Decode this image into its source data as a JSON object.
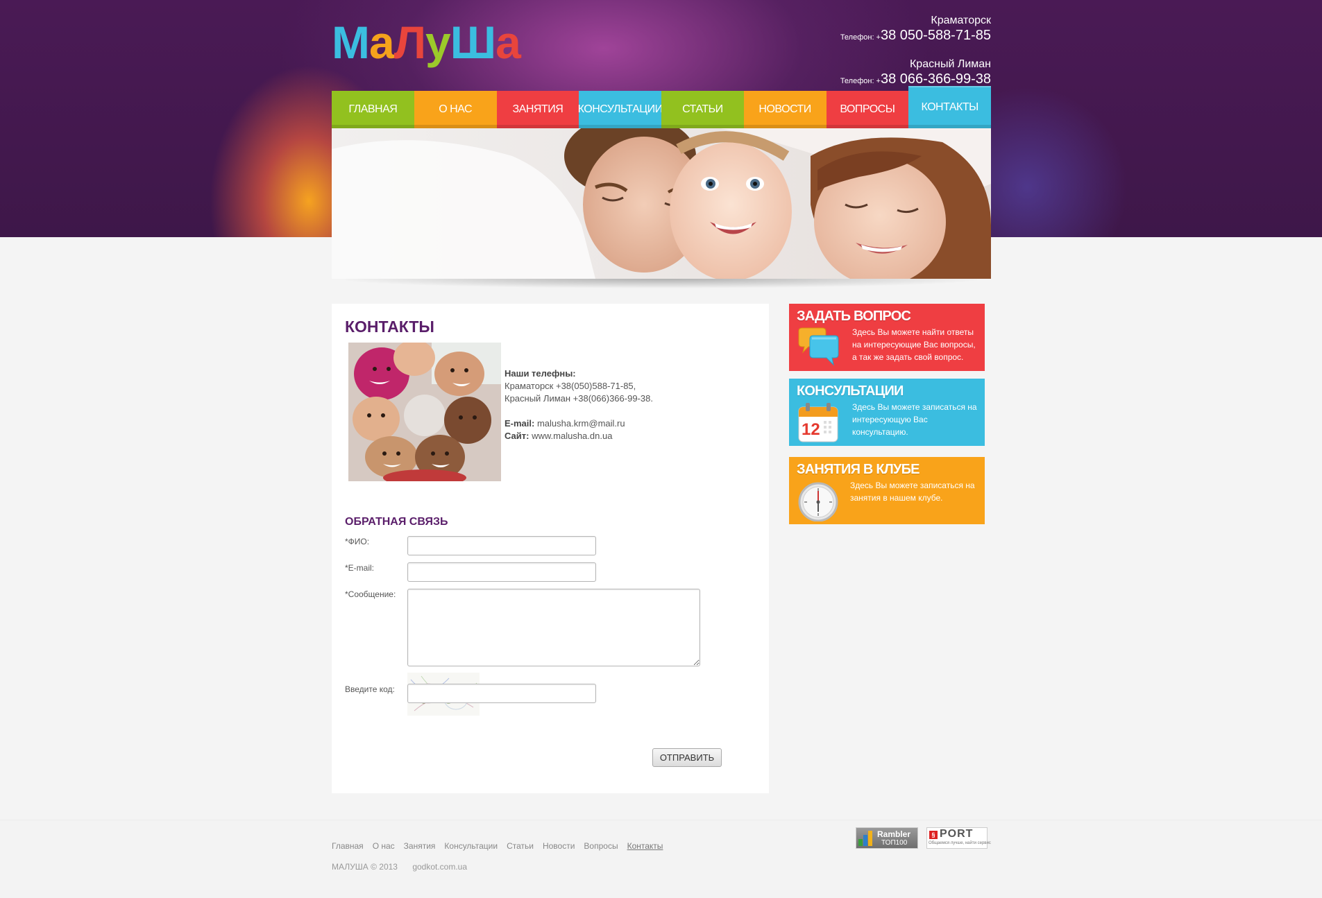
{
  "brand": {
    "logo_letters": [
      {
        "char": "М",
        "color": "#3bbde0"
      },
      {
        "char": "а",
        "color": "#f5a21c"
      },
      {
        "char": "Л",
        "color": "#e8453c"
      },
      {
        "char": "у",
        "color": "#9cc92a"
      },
      {
        "char": "Ш",
        "color": "#3bbde0"
      },
      {
        "char": "а",
        "color": "#e8453c"
      }
    ]
  },
  "header": {
    "city1": "Краматорск",
    "phone1_label": "Телефон: +",
    "phone1": "38 050-588-71-85",
    "city2": "Красный Лиман",
    "phone2_label": "Телефон: +",
    "phone2": "38 066-366-99-38"
  },
  "nav": {
    "items": [
      {
        "label": "ГЛАВНАЯ",
        "color": "#92c11f",
        "active": false
      },
      {
        "label": "О НАС",
        "color": "#f9a31a",
        "active": false
      },
      {
        "label": "ЗАНЯТИЯ",
        "color": "#ef3e42",
        "active": false
      },
      {
        "label": "КОНСУЛЬТАЦИИ",
        "color": "#3bbde0",
        "active": false
      },
      {
        "label": "СТАТЬИ",
        "color": "#92c11f",
        "active": false
      },
      {
        "label": "НОВОСТИ",
        "color": "#f9a31a",
        "active": false
      },
      {
        "label": "ВОПРОСЫ",
        "color": "#ef3e42",
        "active": false
      },
      {
        "label": "КОНТАКТЫ",
        "color": "#3bbde0",
        "active": true
      }
    ]
  },
  "main": {
    "title": "КОНТАКТЫ",
    "phones_label": "Наши телефны:",
    "phone_line1": "Краматорск +38(050)588-71-85,",
    "phone_line2": "Красный Лиман +38(066)366-99-38.",
    "email_label": "E-mail:",
    "email": "malusha.krm@mail.ru",
    "site_label": "Сайт:",
    "site": "www.malusha.dn.ua"
  },
  "feedback": {
    "title": "ОБРАТНАЯ СВЯЗЬ",
    "name_label": "*ФИО:",
    "name_value": "",
    "email_label": "*E-mail:",
    "email_value": "",
    "message_label": "*Сообщение:",
    "message_value": "",
    "captcha_text": "b8cv",
    "code_label": "Введите код:",
    "code_value": "",
    "submit_label": "ОТПРАВИТЬ"
  },
  "sidebar": {
    "widgets": [
      {
        "title": "ЗАДАТЬ ВОПРОС",
        "text": "Здесь Вы можете найти ответы на интересующие Вас вопросы, а так же задать свой вопрос.",
        "color": "#ef3e42",
        "icon": "chat-bubbles-icon"
      },
      {
        "title": "КОНСУЛЬТАЦИИ",
        "text": "Здесь Вы можете записаться на интересующую Вас консультацию.",
        "color": "#3bbde0",
        "icon": "calendar-icon",
        "icon_text": "12"
      },
      {
        "title": "ЗАНЯТИЯ В КЛУБЕ",
        "text": "Здесь Вы можете записаться на занятия в нашем клубе.",
        "color": "#f9a31a",
        "icon": "clock-icon"
      }
    ]
  },
  "footer": {
    "links": [
      "Главная",
      "О нас",
      "Занятия",
      "Консультации",
      "Статьи",
      "Новости",
      "Вопросы",
      "Контакты"
    ],
    "active_link": "Контакты",
    "copyright": "МАЛУША  © 2013",
    "credit": "godkot.com.ua",
    "rambler_line1": "Rambler",
    "rambler_line2": "ТОП100",
    "port_logo": "PORT",
    "port_tagline": "Общаемся лучше, найти сервис"
  }
}
